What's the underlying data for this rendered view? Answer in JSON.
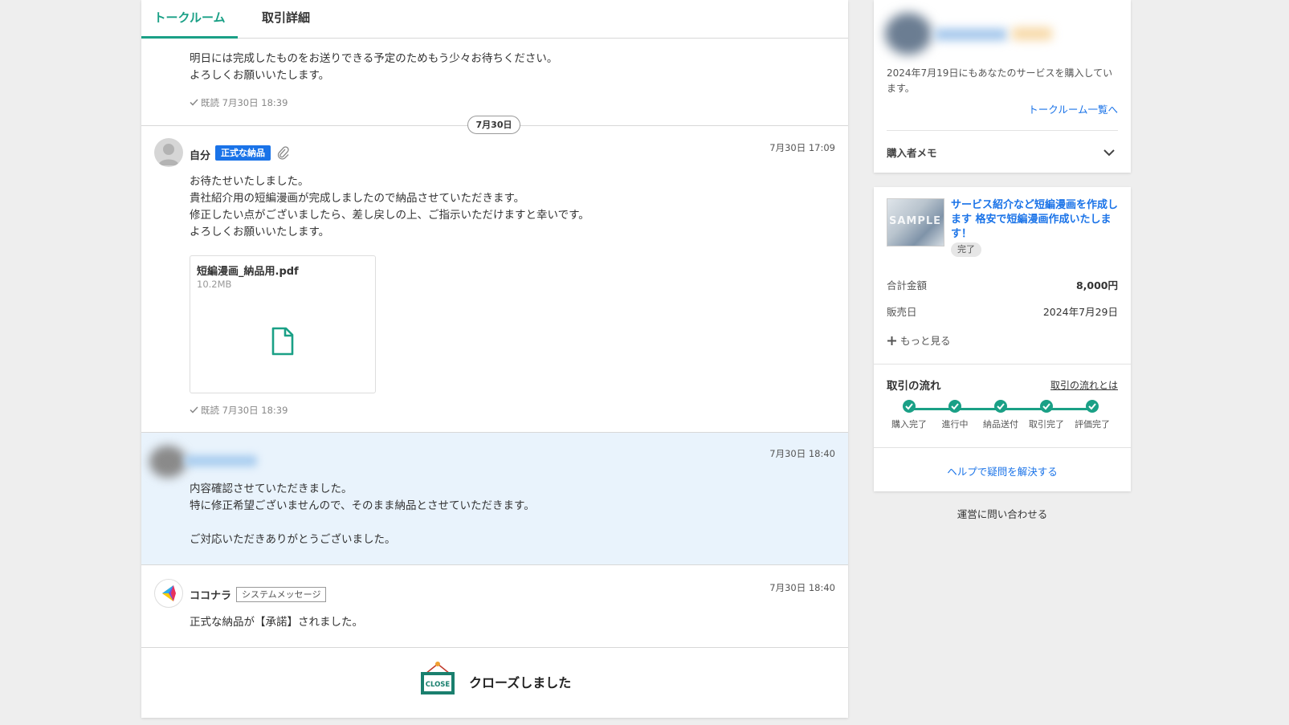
{
  "tabs": {
    "talkroom": "トークルーム",
    "details": "取引詳細"
  },
  "msg0": {
    "text": "明日には完成したものをお送りできる予定のためもう少々お待ちください。\nよろしくお願いいたします。",
    "read_status": "既読 7月30日 18:39"
  },
  "date_divider": "7月30日",
  "msg1": {
    "sender": "自分",
    "badge": "正式な納品",
    "time": "7月30日 17:09",
    "text": "お待たせいたしました。\n貴社紹介用の短編漫画が完成しましたので納品させていただきます。\n修正したい点がございましたら、差し戻しの上、ご指示いただけますと幸いです。\nよろしくお願いいたします。",
    "file": {
      "name": "短編漫画_納品用.pdf",
      "size": "10.2MB"
    },
    "read_status": "既読 7月30日 18:39"
  },
  "msg2": {
    "time": "7月30日 18:40",
    "text": "内容確認させていただきました。\n特に修正希望ございませんので、そのまま納品とさせていただきます。\n\nご対応いただきありがとうございました。"
  },
  "msg3": {
    "sender": "ココナラ",
    "badge": "システムメッセージ",
    "time": "7月30日 18:40",
    "text": "正式な納品が【承諾】されました。"
  },
  "closed": {
    "sign": "CLOSE",
    "label": "クローズしました"
  },
  "buyer_card": {
    "purchase_note": "2024年7月19日にもあなたのサービスを購入しています。",
    "talkroom_list_link": "トークルーム一覧へ",
    "memo_label": "購入者メモ"
  },
  "order_card": {
    "thumb_watermark": "SAMPLE",
    "service_title": "サービス紹介など短編漫画を作成します 格安で短編漫画作成いたします！",
    "status": "完了",
    "total_label": "合計金額",
    "total_value": "8,000円",
    "sale_date_label": "販売日",
    "sale_date_value": "2024年7月29日",
    "more": "もっと見る",
    "flow_title": "取引の流れ",
    "flow_link": "取引の流れとは",
    "steps": [
      "購入完了",
      "進行中",
      "納品送付",
      "取引完了",
      "評価完了"
    ],
    "help": "ヘルプで疑問を解決する"
  },
  "contact": "運営に問い合わせる",
  "colors": {
    "accent_green": "#1aa086",
    "link_blue": "#1a73e8",
    "buyer_bg": "#e9f3fc"
  }
}
